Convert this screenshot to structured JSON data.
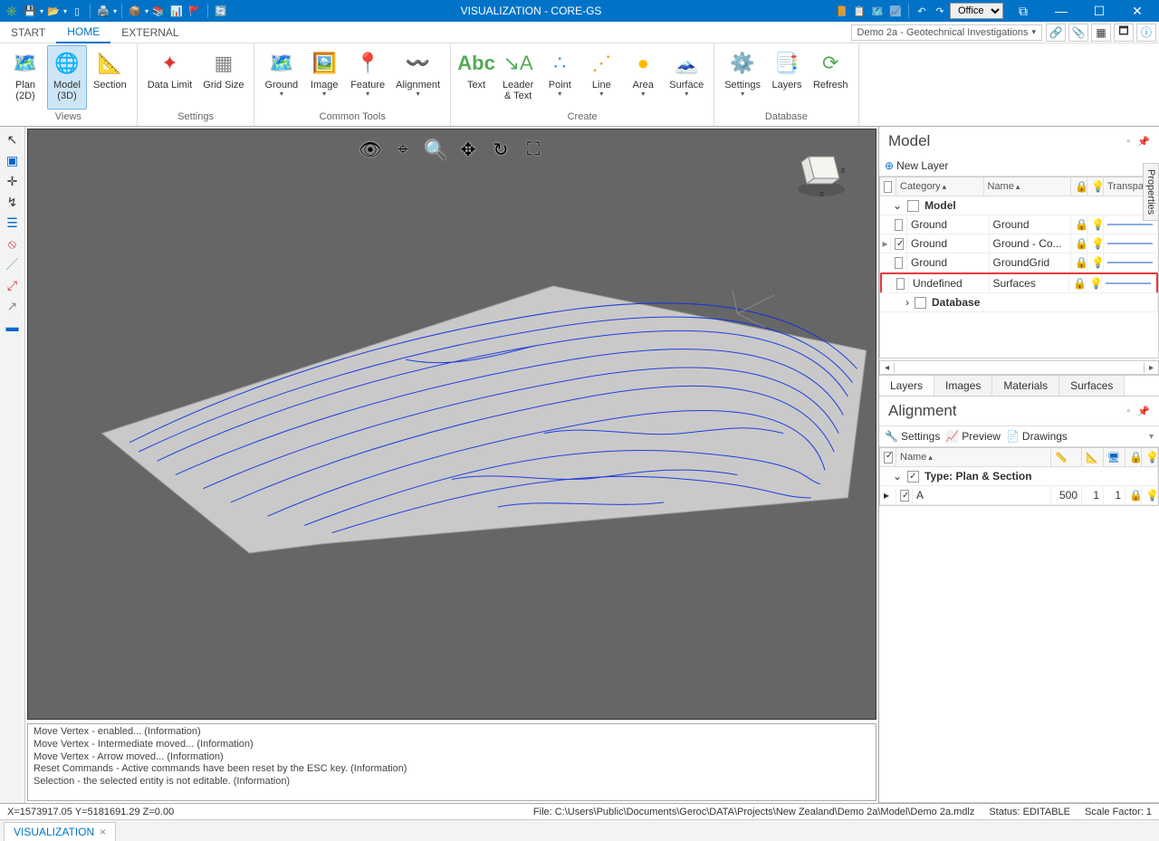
{
  "app": {
    "title": "VISUALIZATION - CORE-GS",
    "theme": "Office"
  },
  "tabs": {
    "start": "START",
    "home": "HOME",
    "external": "EXTERNAL"
  },
  "breadcrumb": "Demo 2a - Geotechnical Investigations",
  "ribbon": {
    "views": {
      "label": "Views",
      "plan2d": "Plan\n(2D)",
      "model3d": "Model\n(3D)",
      "section": "Section"
    },
    "settings": {
      "label": "Settings",
      "datalimit": "Data Limit",
      "gridsize": "Grid Size"
    },
    "common": {
      "label": "Common Tools",
      "ground": "Ground",
      "image": "Image",
      "feature": "Feature",
      "alignment": "Alignment"
    },
    "create": {
      "label": "Create",
      "text": "Text",
      "leader": "Leader\n& Text",
      "point": "Point",
      "line": "Line",
      "area": "Area",
      "surface": "Surface"
    },
    "database": {
      "label": "Database",
      "settings": "Settings",
      "layers": "Layers",
      "refresh": "Refresh"
    },
    "abc": "Abc"
  },
  "model_panel": {
    "title": "Model",
    "new_layer": "New Layer",
    "cols": {
      "category": "Category",
      "name": "Name",
      "transparency": "Transparenc"
    },
    "root": "Model",
    "rows": [
      {
        "cat": "Ground",
        "name": "Ground",
        "chk": false,
        "lockGold": false
      },
      {
        "cat": "Ground",
        "name": "Ground - Co...",
        "chk": true,
        "lockGold": true,
        "expand": true
      },
      {
        "cat": "Ground",
        "name": "GroundGrid",
        "chk": false,
        "lockGold": false
      },
      {
        "cat": "Undefined",
        "name": "Surfaces",
        "chk": false,
        "lockGold": false,
        "hl": true
      }
    ],
    "db": "Database",
    "tabs": {
      "layers": "Layers",
      "images": "Images",
      "materials": "Materials",
      "surfaces": "Surfaces"
    }
  },
  "align_panel": {
    "title": "Alignment",
    "settings": "Settings",
    "preview": "Preview",
    "drawings": "Drawings",
    "name_col": "Name",
    "type_row": "Type: Plan & Section",
    "row": {
      "name": "A",
      "v1": "500",
      "v2": "1",
      "v3": "1"
    }
  },
  "log": [
    "Move Vertex - enabled... (Information)",
    "Move Vertex - Intermediate moved... (Information)",
    "Move Vertex - Arrow moved... (Information)",
    "Reset Commands - Active commands have been reset by the ESC key. (Information)",
    "Selection - the selected entity is not editable. (Information)"
  ],
  "status": {
    "coords": "X=1573917.05   Y=5181691.29   Z=0.00",
    "file": "File: C:\\Users\\Public\\Documents\\Geroc\\DATA\\Projects\\New Zealand\\Demo 2a\\Model\\Demo 2a.mdlz",
    "state": "Status: EDITABLE",
    "scale": "Scale Factor: 1"
  },
  "doctab": "VISUALIZATION",
  "properties": "Properties"
}
